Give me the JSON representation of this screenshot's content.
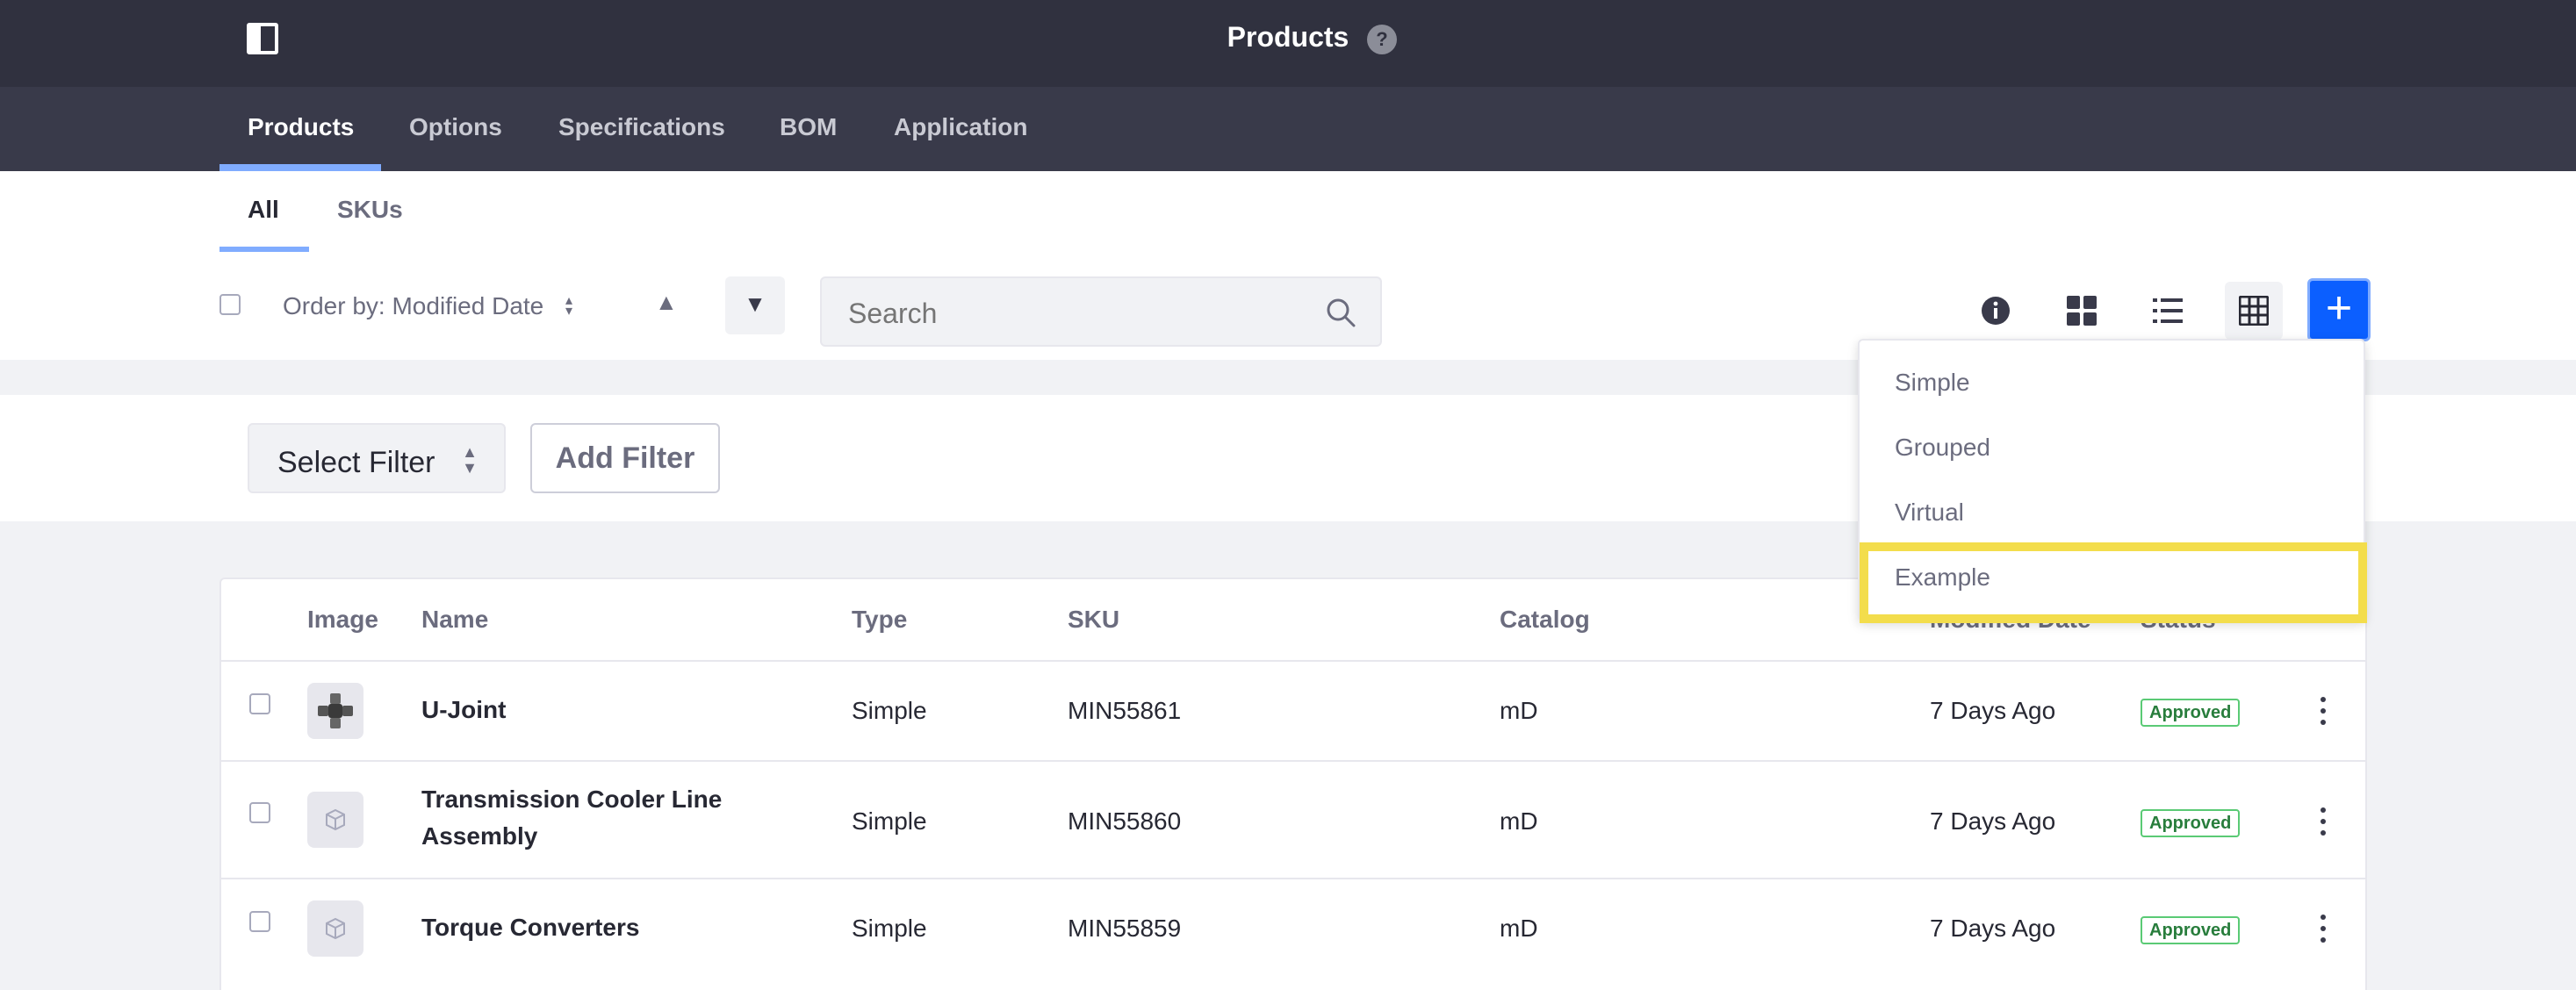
{
  "header": {
    "title": "Products",
    "help_symbol": "?"
  },
  "nav_tabs": [
    {
      "label": "Products",
      "active": true
    },
    {
      "label": "Options"
    },
    {
      "label": "Specifications"
    },
    {
      "label": "BOM"
    },
    {
      "label": "Application"
    }
  ],
  "sub_tabs": [
    {
      "label": "All",
      "active": true
    },
    {
      "label": "SKUs"
    }
  ],
  "toolbar": {
    "order_label": "Order by: Modified Date",
    "search_placeholder": "Search",
    "accent_color": "#0b5fff",
    "view_icons": [
      "info-icon",
      "cards-icon",
      "list-icon",
      "table-icon"
    ],
    "active_view": "table-icon"
  },
  "filters": {
    "select_label": "Select Filter",
    "add_label": "Add Filter"
  },
  "table": {
    "columns": [
      "Image",
      "Name",
      "Type",
      "SKU",
      "Catalog",
      "Modified Date",
      "Status"
    ],
    "rows": [
      {
        "name": "U-Joint",
        "type": "Simple",
        "sku": "MIN55861",
        "catalog": "mD",
        "modified": "7 Days Ago",
        "status": "Approved"
      },
      {
        "name": "Transmission Cooler Line Assembly",
        "type": "Simple",
        "sku": "MIN55860",
        "catalog": "mD",
        "modified": "7 Days Ago",
        "status": "Approved"
      },
      {
        "name": "Torque Converters",
        "type": "Simple",
        "sku": "MIN55859",
        "catalog": "mD",
        "modified": "7 Days Ago",
        "status": "Approved"
      }
    ]
  },
  "add_menu": {
    "items": [
      "Simple",
      "Grouped",
      "Virtual",
      "Example"
    ],
    "highlighted": "Example",
    "highlight_color": "#f3dd4c"
  }
}
